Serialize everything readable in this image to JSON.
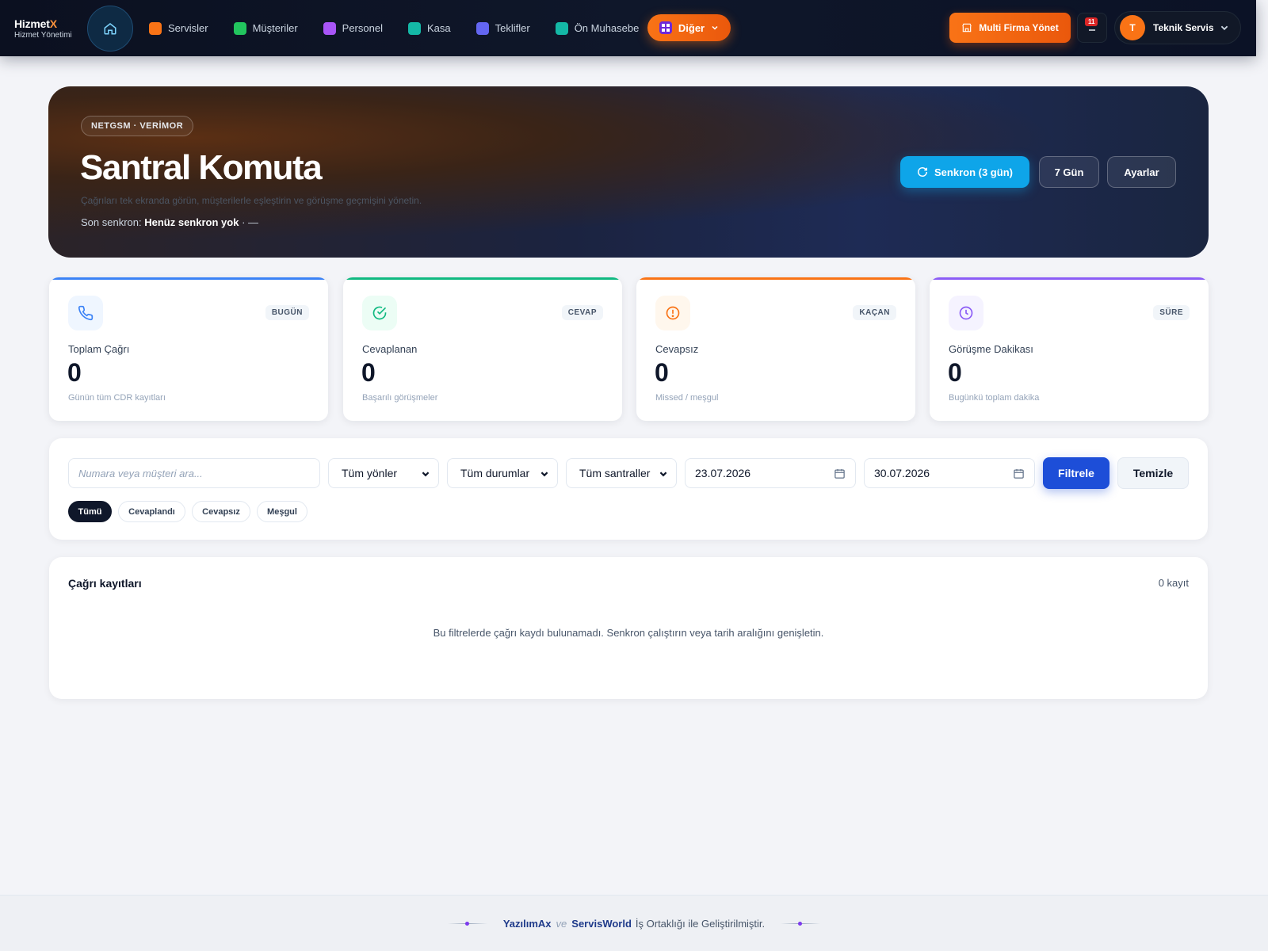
{
  "brand": {
    "name": "HizmetX",
    "name_main": "Hizmet",
    "name_accent": "X",
    "subtitle": "Hizmet Yönetimi"
  },
  "nav": {
    "items": [
      {
        "label": "Servisler",
        "color": "#f97316"
      },
      {
        "label": "Müşteriler",
        "color": "#22c55e"
      },
      {
        "label": "Personel",
        "color": "#a855f7"
      },
      {
        "label": "Kasa",
        "color": "#14b8a6"
      },
      {
        "label": "Teklifler",
        "color": "#6366f1"
      },
      {
        "label": "Ön Muhasebe",
        "color": "#14b8a6"
      }
    ],
    "more_label": "Diğer",
    "multi_firm_label": "Multi Firma Yönet",
    "notification_count": "11",
    "user_initial": "T",
    "user_name": "Teknik Servis"
  },
  "hero": {
    "tag": "NETGSM · VERİMOR",
    "title": "Santral Komuta",
    "subtitle": "Çağrıları tek ekranda görün, müşterilerle eşleştirin ve görüşme geçmişini yönetin.",
    "last_sync_label": "Son senkron:",
    "last_sync_value": "Henüz senkron yok",
    "last_sync_extra": "·  —",
    "buttons": {
      "sync": "Senkron (3 gün)",
      "days": "7 Gün",
      "settings": "Ayarlar"
    }
  },
  "stats": [
    {
      "badge": "BUGÜN",
      "label": "Toplam Çağrı",
      "value": "0",
      "hint": "Günün tüm CDR kayıtları",
      "color": "#3b82f6",
      "icon": "phone-icon"
    },
    {
      "badge": "CEVAP",
      "label": "Cevaplanan",
      "value": "0",
      "hint": "Başarılı görüşmeler",
      "color": "#10b981",
      "icon": "check-circle-icon"
    },
    {
      "badge": "KAÇAN",
      "label": "Cevapsız",
      "value": "0",
      "hint": "Missed / meşgul",
      "color": "#f97316",
      "icon": "alert-circle-icon"
    },
    {
      "badge": "SÜRE",
      "label": "Görüşme Dakikası",
      "value": "0",
      "hint": "Bugünkü toplam dakika",
      "color": "#8b5cf6",
      "icon": "clock-icon"
    }
  ],
  "filters": {
    "search_placeholder": "Numara veya müşteri ara...",
    "direction": "Tüm yönler",
    "status": "Tüm durumlar",
    "pbx": "Tüm santraller",
    "date_from": "23.07.2026",
    "date_to": "30.07.2026",
    "apply": "Filtrele",
    "clear": "Temizle",
    "chips": [
      "Tümü",
      "Cevaplandı",
      "Cevapsız",
      "Meşgul"
    ],
    "active_chip": "Tümü"
  },
  "records": {
    "title": "Çağrı kayıtları",
    "count": "0 kayıt",
    "empty": "Bu filtrelerde çağrı kaydı bulunamadı. Senkron çalıştırın veya tarih aralığını genişletin."
  },
  "footer": {
    "brand1": "YazılımAx",
    "joiner": "ve",
    "brand2": "ServisWorld",
    "text": "İş Ortaklığı ile Geliştirilmiştir."
  }
}
